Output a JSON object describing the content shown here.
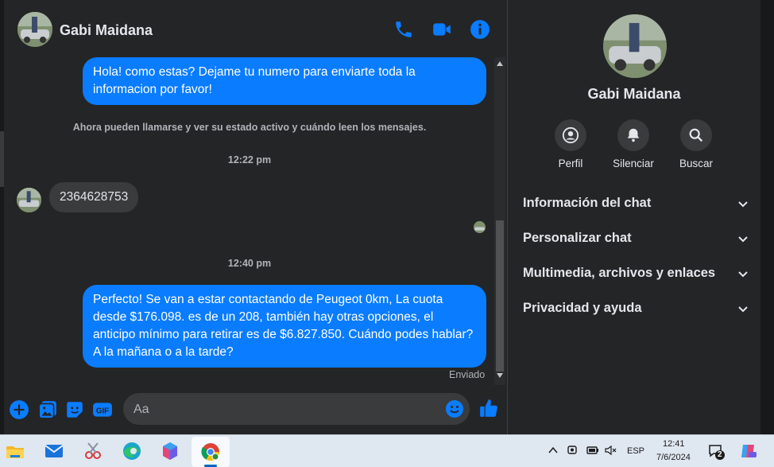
{
  "header": {
    "contact_name": "Gabi Maidana"
  },
  "messages": {
    "out1": "Hola! como estas? Dejame tu numero para enviarte toda la informacion por favor!",
    "system": "Ahora pueden llamarse y ver su estado activo y cuándo leen los mensajes.",
    "time1": "12:22 pm",
    "in1": "2364628753",
    "time2": "12:40 pm",
    "out2": "Perfecto!  Se van a estar contactando de Peugeot 0km, La cuota desde $176.098. es de un 208, también hay otras opciones, el anticipo mínimo para retirar es de $6.827.850. Cuándo podes hablar? A la mañana o a la tarde?",
    "status": "Enviado"
  },
  "composer": {
    "placeholder": "Aa"
  },
  "sidebar": {
    "name": "Gabi Maidana",
    "actions": [
      "Perfil",
      "Silenciar",
      "Buscar"
    ],
    "sections": [
      "Información del chat",
      "Personalizar chat",
      "Multimedia, archivos y enlaces",
      "Privacidad y ayuda"
    ]
  },
  "taskbar": {
    "language": "ESP",
    "time": "12:41",
    "date": "7/6/2024",
    "notifications": "2"
  },
  "colors": {
    "accent": "#0a7cff",
    "background": "#242526",
    "bubble_in": "#3a3b3c"
  }
}
